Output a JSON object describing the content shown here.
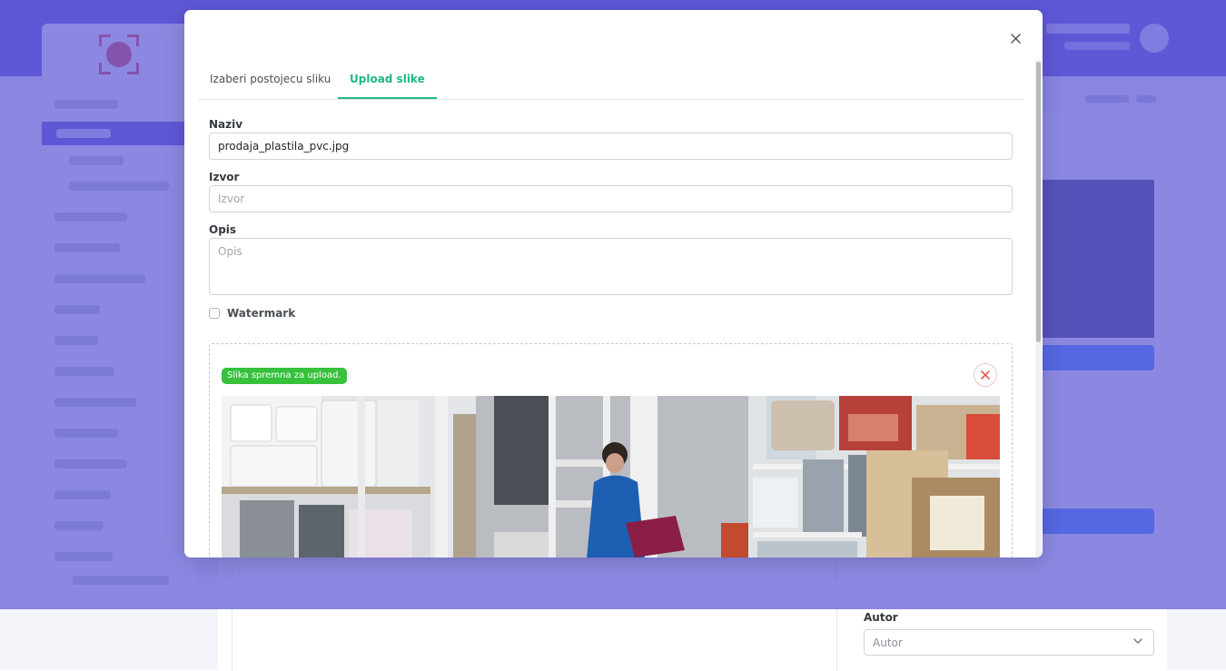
{
  "modal": {
    "tabs": [
      {
        "label": "Izaberi postojecu sliku",
        "active": false
      },
      {
        "label": "Upload slike",
        "active": true
      }
    ],
    "fields": {
      "naziv": {
        "label": "Naziv",
        "value": "prodaja_plastila_pvc.jpg",
        "placeholder": "Naziv"
      },
      "izvor": {
        "label": "Izvor",
        "value": "",
        "placeholder": "Izvor"
      },
      "opis": {
        "label": "Opis",
        "value": "",
        "placeholder": "Opis"
      }
    },
    "watermark": {
      "label": "Watermark",
      "checked": false
    },
    "upload": {
      "status": "Slika spremna za upload.",
      "status_color": "#37c13c"
    }
  },
  "background": {
    "autor": {
      "label": "Autor",
      "placeholder": "Autor"
    }
  },
  "colors": {
    "accent": "#1eb980",
    "header": "#5b55d6",
    "primary_button": "#3d8bfd",
    "danger": "#e3463f"
  },
  "icons": [
    "close-icon",
    "remove-x-icon",
    "chevron-down-icon",
    "logo-icon"
  ]
}
